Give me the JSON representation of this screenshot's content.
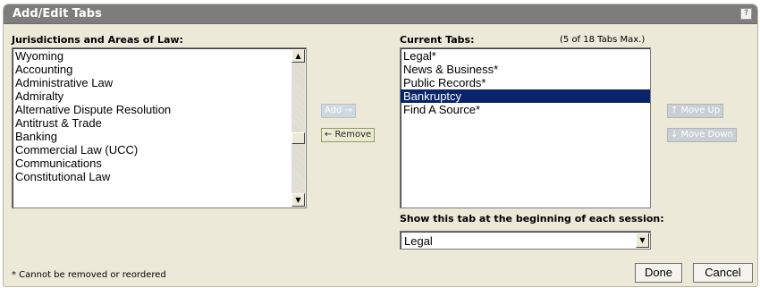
{
  "dialog": {
    "title": "Add/Edit Tabs",
    "help_label": "?"
  },
  "jurisdictions": {
    "label": "Jurisdictions and Areas of Law:",
    "items": [
      "Wyoming",
      "Accounting",
      "Administrative Law",
      "Admiralty",
      "Alternative Dispute Resolution",
      "Antitrust & Trade",
      "Banking",
      "Commercial Law (UCC)",
      "Communications",
      "Constitutional Law"
    ]
  },
  "buttons": {
    "add_label": "Add →",
    "remove_label": "← Remove",
    "move_up_label": "↑ Move Up",
    "move_down_label": "↓ Move Down",
    "done_label": "Done",
    "cancel_label": "Cancel"
  },
  "current_tabs": {
    "label": "Current Tabs:",
    "count_label": "(5 of 18 Tabs Max.)",
    "items": [
      {
        "label": "Legal*",
        "selected": false
      },
      {
        "label": "News & Business*",
        "selected": false
      },
      {
        "label": "Public Records*",
        "selected": false
      },
      {
        "label": "Bankruptcy",
        "selected": true
      },
      {
        "label": "Find A Source*",
        "selected": false
      }
    ]
  },
  "start_tab": {
    "label": "Show this tab at the beginning of each session:",
    "value": "Legal"
  },
  "footnote": "* Cannot be removed or reordered",
  "icons": {
    "scroll_up": "scroll-up-arrow-icon",
    "scroll_down": "scroll-down-arrow-icon",
    "dropdown": "chevron-down-icon"
  },
  "colors": {
    "titlebar": "#7d7d7d",
    "dialog_bg": "#ece9d8",
    "selection": "#0a246a"
  }
}
